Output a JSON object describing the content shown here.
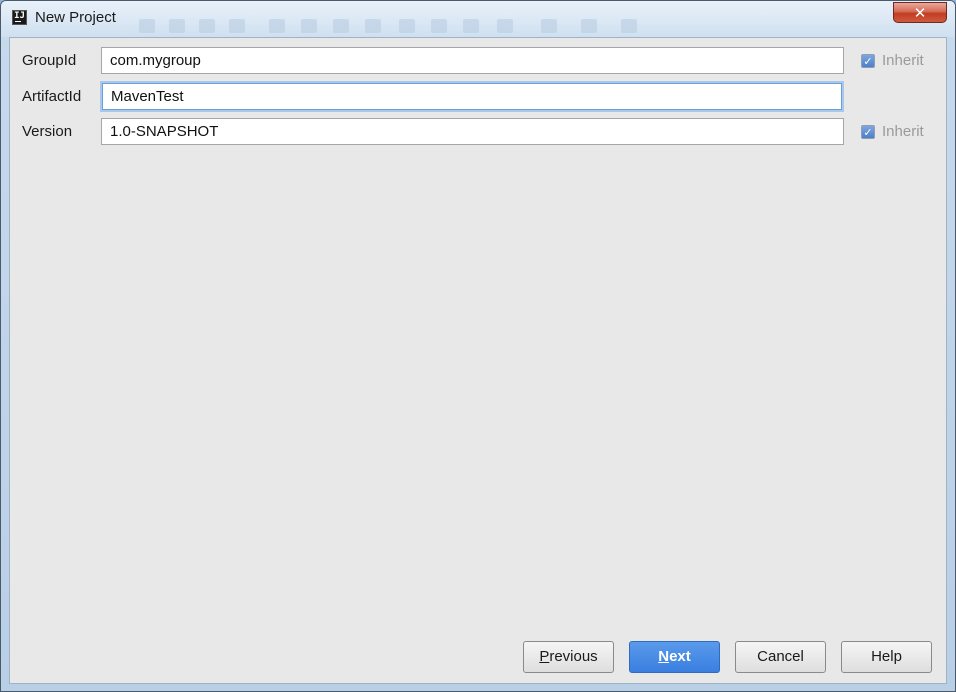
{
  "window": {
    "title": "New Project",
    "close_glyph": "✕"
  },
  "form": {
    "group_id": {
      "label": "GroupId",
      "value": "com.mygroup",
      "inherit_label": "Inherit",
      "inherit_checked": true
    },
    "artifact_id": {
      "label": "ArtifactId",
      "value": "MavenTest"
    },
    "version": {
      "label": "Version",
      "value": "1.0-SNAPSHOT",
      "inherit_label": "Inherit",
      "inherit_checked": true
    }
  },
  "buttons": {
    "previous": {
      "mnemonic": "P",
      "rest": "revious"
    },
    "next": {
      "mnemonic": "N",
      "rest": "ext"
    },
    "cancel": "Cancel",
    "help": "Help"
  },
  "icons": {
    "app": "intellij-app-icon",
    "check": "✓"
  },
  "colors": {
    "primary_button": "#3a7fe0",
    "focus_ring": "#a8c9ec",
    "dialog_bg": "#e8e8e8",
    "disabled_text": "#9a9a9a"
  }
}
